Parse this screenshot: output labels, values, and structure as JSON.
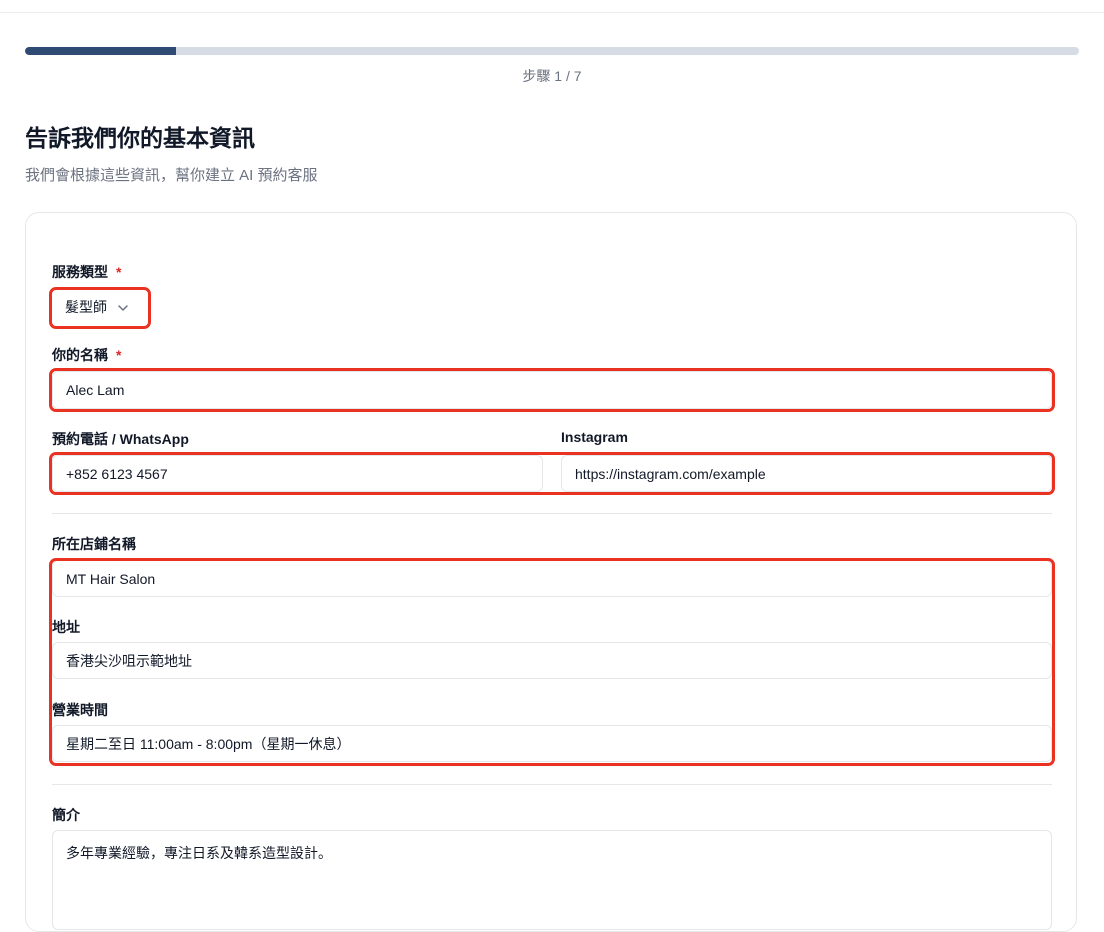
{
  "progress": {
    "fraction": 0.143,
    "step_text": "步驟 1 / 7"
  },
  "header": {
    "title": "告訴我們你的基本資訊",
    "subtitle": "我們會根據這些資訊，幫你建立 AI 預約客服"
  },
  "form": {
    "service_type": {
      "label": "服務類型",
      "required_mark": "*",
      "value": "髮型師"
    },
    "name": {
      "label": "你的名稱",
      "required_mark": "*",
      "value": "Alec Lam"
    },
    "phone": {
      "label": "預約電話 / WhatsApp",
      "value": "+852 6123 4567"
    },
    "instagram": {
      "label": "Instagram",
      "value": "https://instagram.com/example"
    },
    "shop_name": {
      "label": "所在店鋪名稱",
      "value": "MT Hair Salon"
    },
    "address": {
      "label": "地址",
      "value": "香港尖沙咀示範地址"
    },
    "hours": {
      "label": "營業時間",
      "value": "星期二至日 11:00am - 8:00pm（星期一休息）"
    },
    "bio": {
      "label": "簡介",
      "value": "多年專業經驗，專注日系及韓系造型設計。"
    }
  },
  "colors": {
    "accent": "#2f4a73",
    "highlight": "#ea3223",
    "required": "#dc2626"
  },
  "icons": {
    "service_select": "chevron-down-icon"
  }
}
